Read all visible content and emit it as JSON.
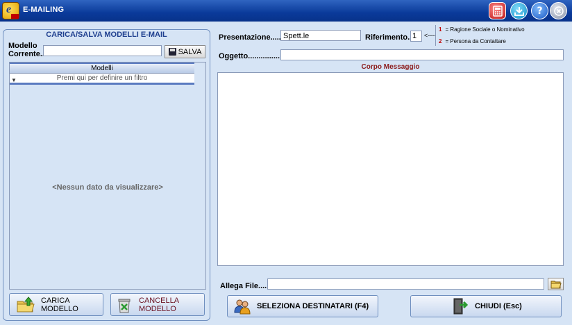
{
  "window": {
    "title": "E-MAILING"
  },
  "left_panel": {
    "title": "CARICA/SALVA MODELLI E-MAIL",
    "current_model_label_1": "Modello",
    "current_model_label_2": "Corrente...",
    "current_model_value": "",
    "save_label": "SALVA",
    "grid": {
      "column_header": "Modelli",
      "filter_row": "Premi qui per definire un filtro",
      "empty_text": "<Nessun dato da visualizzare>"
    },
    "load_label": "CARICA MODELLO",
    "delete_label": "CANCELLA MODELLO"
  },
  "form": {
    "presentazione_label": "Presentazione.......",
    "presentazione_value": "Spett.le",
    "riferimento_label": "Riferimento....",
    "riferimento_value": "1",
    "arrow_hint": "<----",
    "legend": [
      {
        "num": "1",
        "text": "= Ragione Sociale o Nominativo"
      },
      {
        "num": "2",
        "text": "= Persona da Contattare"
      }
    ],
    "oggetto_label": "Oggetto...............",
    "oggetto_value": "",
    "corpo_title": "Corpo Messaggio",
    "corpo_value": "",
    "allega_label": "Allega File......",
    "allega_value": ""
  },
  "footer": {
    "select_recipients_label": "SELEZIONA DESTINATARI (F4)",
    "close_label": "CHIUDI  (Esc)"
  },
  "colors": {
    "title_bar": "#0a3a9a",
    "panel_title": "#1f3f8f",
    "accent_red": "#c00000",
    "corpo_title": "#8b1a1a"
  }
}
